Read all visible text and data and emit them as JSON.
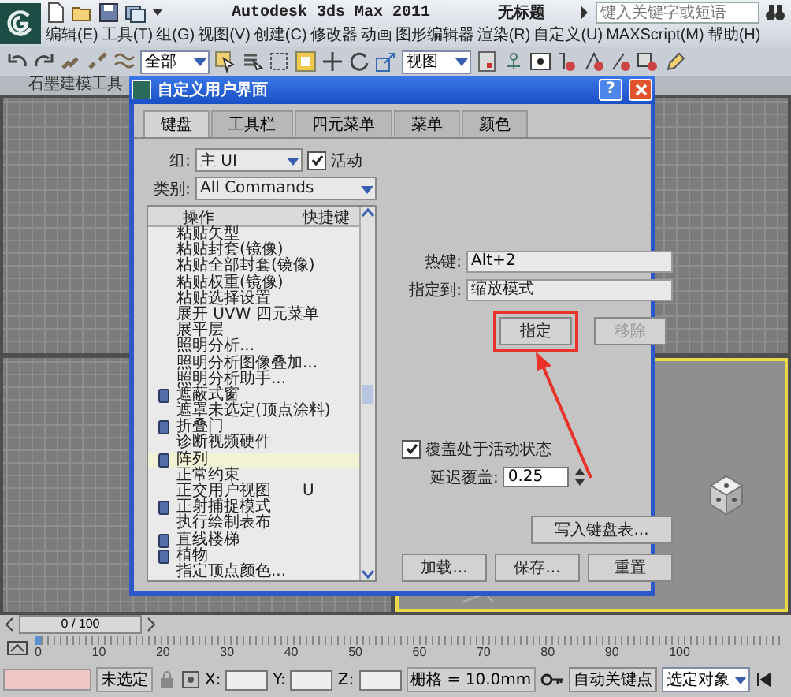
{
  "title_bar": {
    "app_title": "Autodesk 3ds Max 2011",
    "document": "无标题",
    "search": {
      "placeholder": "键入关键字或短语"
    }
  },
  "menu_bar": [
    "编辑(E)",
    "工具(T)",
    "组(G)",
    "视图(V)",
    "创建(C)",
    "修改器",
    "动画",
    "图形编辑器",
    "渲染(R)",
    "自定义(U)",
    "MAXScript(M)",
    "帮助(H)"
  ],
  "toolbar": {
    "selection_filter": "全部",
    "reference_coordinate": "视图"
  },
  "ribbon": {
    "tab": "石墨建模工具"
  },
  "viewports": [
    {
      "kind": "ortho",
      "active": false
    },
    {
      "kind": "ortho",
      "active": false
    },
    {
      "kind": "ortho",
      "active": false
    },
    {
      "kind": "perspective",
      "active": true
    }
  ],
  "dialog": {
    "title": "自定义用户界面",
    "help_button": "?",
    "tabs": [
      {
        "label": "键盘",
        "selected": true
      },
      {
        "label": "工具栏",
        "selected": false
      },
      {
        "label": "四元菜单",
        "selected": false
      },
      {
        "label": "菜单",
        "selected": false
      },
      {
        "label": "颜色",
        "selected": false
      }
    ],
    "group": {
      "label": "组:",
      "value": "主 UI"
    },
    "active_checkbox": {
      "label": "活动",
      "checked": true
    },
    "category": {
      "label": "类别:",
      "value": "All Commands"
    },
    "action_list": {
      "columns": [
        "操作",
        "快捷键"
      ],
      "rows": [
        {
          "action": "粘贴矢型",
          "kind": "plain",
          "selected": false
        },
        {
          "action": "粘贴封套(镜像)",
          "kind": "plain",
          "selected": false
        },
        {
          "action": "粘贴全部封套(镜像)",
          "kind": "plain",
          "selected": false
        },
        {
          "action": "粘贴权重(镜像)",
          "kind": "plain",
          "selected": false
        },
        {
          "action": "粘贴选择设置",
          "kind": "plain",
          "selected": false
        },
        {
          "action": "展开 UVW 四元菜单",
          "kind": "plain",
          "selected": false
        },
        {
          "action": "展平层",
          "kind": "plain",
          "selected": false
        },
        {
          "action": "照明分析...",
          "kind": "plain",
          "selected": false
        },
        {
          "action": "照明分析图像叠加...",
          "kind": "plain",
          "selected": false
        },
        {
          "action": "照明分析助手...",
          "kind": "plain",
          "selected": false
        },
        {
          "action": "遮蔽式窗",
          "kind": "icon",
          "selected": false
        },
        {
          "action": "遮罩未选定(顶点涂料)",
          "kind": "plain",
          "selected": false
        },
        {
          "action": "折叠门",
          "kind": "icon",
          "selected": false
        },
        {
          "action": "诊断视频硬件",
          "kind": "plain",
          "selected": false
        },
        {
          "action": "阵列",
          "kind": "icon",
          "selected": true
        },
        {
          "action": "正常约束",
          "kind": "plain",
          "selected": false
        },
        {
          "action": "正交用户视图",
          "shortcut": "U",
          "kind": "plain",
          "selected": false
        },
        {
          "action": "正射捕捉模式",
          "kind": "icon",
          "selected": false
        },
        {
          "action": "执行绘制表布",
          "kind": "plain",
          "selected": false
        },
        {
          "action": "直线楼梯",
          "kind": "icon",
          "selected": false
        },
        {
          "action": "植物",
          "kind": "icon",
          "selected": false
        },
        {
          "action": "指定顶点颜色...",
          "kind": "plain",
          "selected": false
        }
      ]
    },
    "hotkey": {
      "label": "热键:",
      "value": "Alt+2"
    },
    "assigned_to": {
      "label": "指定到:",
      "value": "缩放模式"
    },
    "buttons": [
      {
        "label": "指定",
        "disabled": false,
        "highlighted": true
      },
      {
        "label": "移除",
        "disabled": true,
        "highlighted": false
      }
    ],
    "override_checkbox": {
      "label": "覆盖处于活动状态",
      "checked": true
    },
    "delay_override": {
      "label": "延迟覆盖:",
      "value": "0.25"
    },
    "write_button": "写入键盘表...",
    "footer_buttons": [
      "加载...",
      "保存...",
      "重置"
    ]
  },
  "time_slider": {
    "frame": "0 / 100",
    "ticks": [
      "0",
      "10",
      "20",
      "30",
      "40",
      "50",
      "60",
      "70",
      "80",
      "90",
      "100"
    ]
  },
  "status_bar": {
    "selection": "未选定",
    "x_label": "X:",
    "y_label": "Y:",
    "z_label": "Z:",
    "grid": "栅格 = 10.0mm",
    "auto_key": "自动关键点",
    "key_filter": "选定对象"
  }
}
